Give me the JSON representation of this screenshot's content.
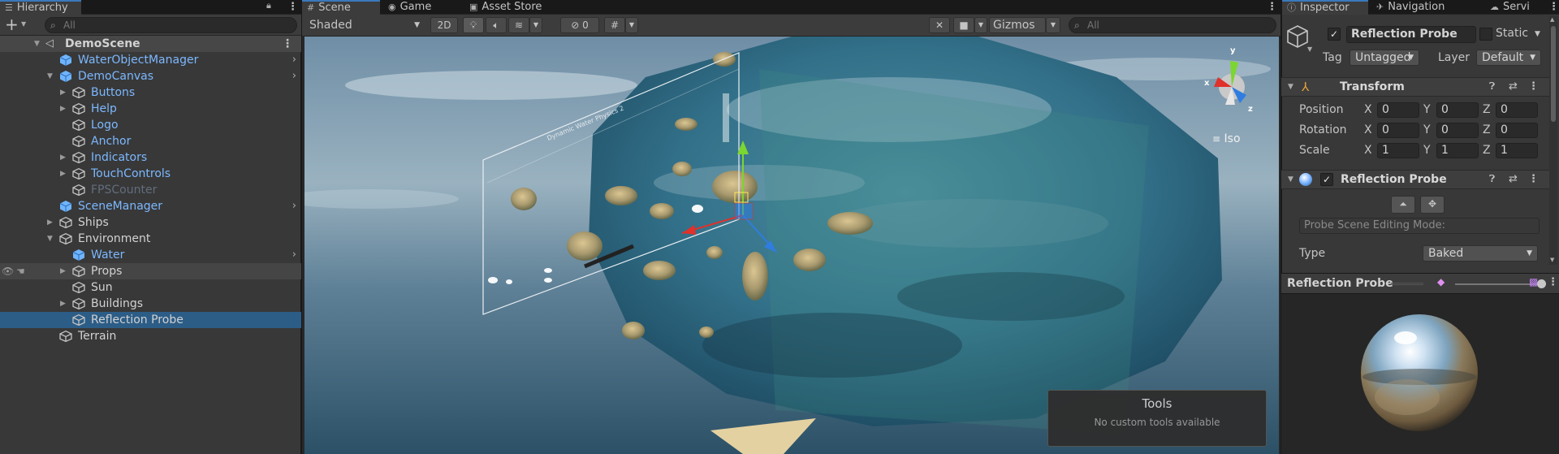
{
  "hierarchy": {
    "tab_label": "Hierarchy",
    "search_placeholder": "All",
    "add_label": "+",
    "rows": [
      {
        "label": "DemoScene"
      },
      {
        "label": "WaterObjectManager"
      },
      {
        "label": "DemoCanvas"
      },
      {
        "label": "Buttons"
      },
      {
        "label": "Help"
      },
      {
        "label": "Logo"
      },
      {
        "label": "Anchor"
      },
      {
        "label": "Indicators"
      },
      {
        "label": "TouchControls"
      },
      {
        "label": "FPSCounter"
      },
      {
        "label": "SceneManager"
      },
      {
        "label": "Ships"
      },
      {
        "label": "Environment"
      },
      {
        "label": "Water"
      },
      {
        "label": "Props"
      },
      {
        "label": "Sun"
      },
      {
        "label": "Buildings"
      },
      {
        "label": "Reflection Probe"
      },
      {
        "label": "Terrain"
      }
    ]
  },
  "center": {
    "tabs": [
      {
        "label": "Scene",
        "icon": "hash-icon"
      },
      {
        "label": "Game",
        "icon": "gamepad-icon"
      },
      {
        "label": "Asset Store",
        "icon": "bag-icon"
      }
    ],
    "toolbar": {
      "shading_mode": "Shaded",
      "mode_2d": "2D",
      "hidden_count": "0",
      "gizmos_label": "Gizmos",
      "search_placeholder": "All"
    },
    "iso_label": "Iso",
    "tools_overlay": {
      "title": "Tools",
      "message": "No custom tools available"
    },
    "canvas_caption": "Dynamic Water Physics 2",
    "colors": {
      "sky": "#5a7d9a",
      "water": "#3f7e93",
      "axis_x": "#e0312b",
      "axis_y": "#7bd62f",
      "axis_z": "#2f7de0"
    }
  },
  "inspector": {
    "tabs": [
      {
        "label": "Inspector"
      },
      {
        "label": "Navigation"
      },
      {
        "label": "Servi"
      }
    ],
    "object_name": "Reflection Probe",
    "static_label": "Static",
    "tag_label": "Tag",
    "tag_value": "Untagged",
    "layer_label": "Layer",
    "layer_value": "Default",
    "transform": {
      "title": "Transform",
      "position_label": "Position",
      "rotation_label": "Rotation",
      "scale_label": "Scale",
      "x_label": "X",
      "y_label": "Y",
      "z_label": "Z",
      "position": [
        "0",
        "0",
        "0"
      ],
      "rotation": [
        "0",
        "0",
        "0"
      ],
      "scale": [
        "1",
        "1",
        "1"
      ]
    },
    "reflection_probe": {
      "title": "Reflection Probe",
      "editing_mode_label": "Probe Scene Editing Mode:",
      "type_label": "Type",
      "type_value": "Baked"
    },
    "preview": {
      "title": "Reflection Probe",
      "exposure_level": 0.95
    },
    "colors": {
      "selection": "#2c5d87",
      "accent": "#3a79bb"
    }
  }
}
